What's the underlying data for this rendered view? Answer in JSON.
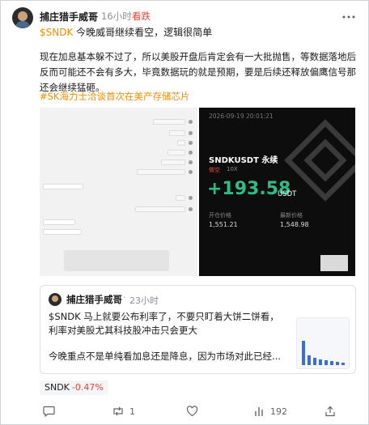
{
  "post": {
    "username": "捕庄猎手威哥",
    "dot": "·",
    "time": "16小时",
    "sentiment": "看跌",
    "ticker": "$SNDK",
    "headline": " 今晚威哥继续看空，逻辑很简单",
    "body": "现在加息基本躲不过了，所以美股开盘后肯定会有一大批抛售，等数据落地后反而可能还不会有多大，毕竟数据玩的就是预期，要是后续还释放偏鹰信号那还会继续猛砸。",
    "hashtag": "#SK海力士洽谈首次在美产存储芯片"
  },
  "screenshot_card": {
    "date": "2026-09-19 20:01:21",
    "pair": "SNDKUSDT 永续",
    "side": "做空",
    "leverage": "10X",
    "pnl": "+193.58",
    "unit": "USDT",
    "open_label": "开仓价格",
    "open_value": "1,551.21",
    "last_label": "最新价格",
    "last_value": "1,548.98"
  },
  "quote": {
    "username": "捕庄猎手威哥",
    "dot": "·",
    "time": "23小时",
    "line1": "$SNDK 马上就要公布利率了，不要只盯着大饼二饼看，",
    "line2": "利率对美股尤其科技股冲击只会更大",
    "line3": "今晚重点不是单纯看加息还是降息，因为市场对此已经..."
  },
  "stock_chip": {
    "ticker": "SNDK",
    "change": "-0.47%"
  },
  "actions": {
    "retweet_count": "1",
    "views_count": "192"
  },
  "colors": {
    "accent_orange": "#f08c00",
    "bearish_red": "#e0463a",
    "profit_green": "#2ebd85"
  }
}
